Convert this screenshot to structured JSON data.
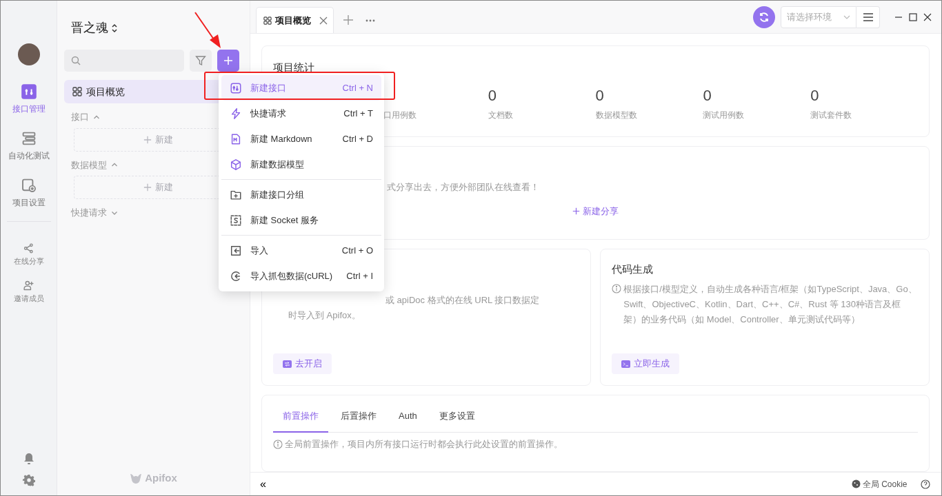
{
  "rail": {
    "items": [
      {
        "label": "接口管理",
        "selected": true
      },
      {
        "label": "自动化测试",
        "selected": false
      },
      {
        "label": "项目设置",
        "selected": false
      }
    ],
    "extra": [
      {
        "label": "在线分享"
      },
      {
        "label": "邀请成员"
      }
    ]
  },
  "sidebar": {
    "project": "晋之魂",
    "nav": [
      {
        "label": "项目概览",
        "selected": true
      }
    ],
    "sections": [
      {
        "label": "接口",
        "expanded": true,
        "new_label": "新建"
      },
      {
        "label": "数据模型",
        "expanded": true,
        "new_label": "新建"
      },
      {
        "label": "快捷请求",
        "expanded": false
      }
    ],
    "brand": "Apifox"
  },
  "menu": {
    "groups": [
      [
        {
          "label": "新建接口",
          "shortcut": "Ctrl + N",
          "selected": true
        },
        {
          "label": "快捷请求",
          "shortcut": "Ctrl + T",
          "selected": false
        },
        {
          "label": "新建 Markdown",
          "shortcut": "Ctrl + D",
          "selected": false
        },
        {
          "label": "新建数据模型",
          "selected": false
        }
      ],
      [
        {
          "label": "新建接口分组",
          "selected": false
        },
        {
          "label": "新建 Socket 服务",
          "selected": false
        }
      ],
      [
        {
          "label": "导入",
          "shortcut": "Ctrl + O",
          "selected": false
        },
        {
          "label": "导入抓包数据(cURL)",
          "shortcut": "Ctrl + I",
          "selected": false
        }
      ]
    ]
  },
  "tabs": [
    {
      "label": "项目概览",
      "selected": true
    }
  ],
  "env": {
    "placeholder": "请选择环境"
  },
  "stats": {
    "title": "项目统计",
    "items": [
      {
        "label": "口用例数"
      },
      {
        "value": "0",
        "label": "文档数"
      },
      {
        "value": "0",
        "label": "数据模型数"
      },
      {
        "value": "0",
        "label": "测试用例数"
      },
      {
        "value": "0",
        "label": "测试套件数"
      }
    ]
  },
  "share": {
    "text": "式分享出去，方便外部团队在线查看！",
    "button": "新建分享"
  },
  "import_card": {
    "text_lines": [
      "或 apiDoc 格式的在线 URL 接口数据定",
      "时导入到 Apifox。"
    ],
    "button": "去开启"
  },
  "codegen": {
    "title": "代码生成",
    "text": "根据接口/模型定义，自动生成各种语言/框架（如TypeScript、Java、Go、Swift、ObjectiveC、Kotlin、Dart、C++、C#、Rust 等 130种语言及框架）的业务代码（如 Model、Controller、单元测试代码等）",
    "button": "立即生成"
  },
  "settings": {
    "tabs": [
      {
        "label": "前置操作",
        "selected": true
      },
      {
        "label": "后置操作",
        "selected": false
      },
      {
        "label": "Auth",
        "selected": false
      },
      {
        "label": "更多设置",
        "selected": false
      }
    ],
    "info": "全局前置操作，项目内所有接口运行时都会执行此处设置的前置操作。"
  },
  "status_bar": {
    "collapse": "«",
    "cookie": "全局 Cookie"
  }
}
